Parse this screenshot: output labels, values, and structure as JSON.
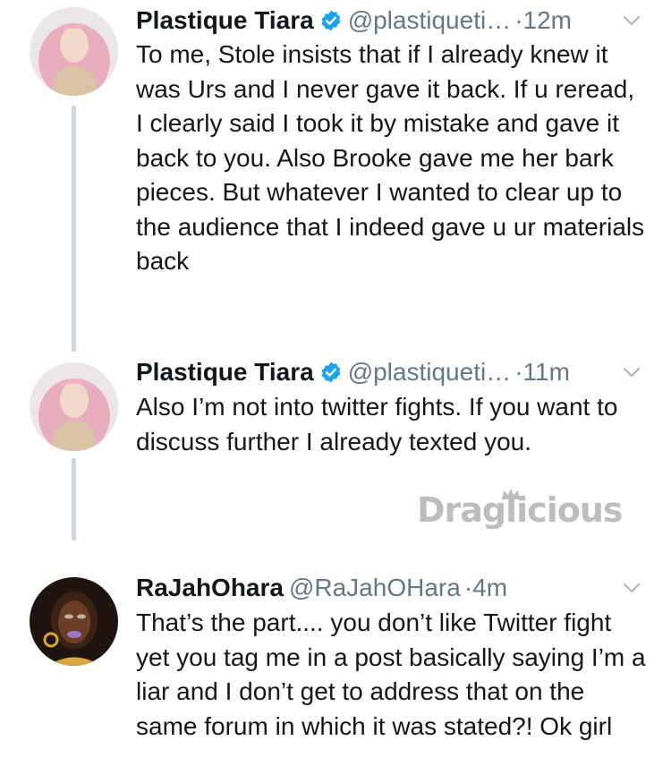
{
  "tweets": [
    {
      "name": "Plastique Tiara",
      "verified": true,
      "handle": "@plastiqueti…",
      "time": "12m",
      "text": "To me, Stole insists that if I already knew it was Urs and I never gave it back. If u reread, I clearly said I took it by mistake and gave it back to you. Also Brooke gave me her bark pieces. But whatever I wanted to clear up to the audience that I indeed gave u ur materials back"
    },
    {
      "name": "Plastique Tiara",
      "verified": true,
      "handle": "@plastiqueti…",
      "time": "11m",
      "text": "Also I’m not into twitter fights. If you want to discuss further I already texted you."
    },
    {
      "name": "RaJahOhara",
      "verified": false,
      "handle": "@RaJahOHara",
      "time": "4m",
      "text": "That’s the part.... you don’t like Twitter fight yet you tag me in a post basically saying I’m a liar and I don’t get to address that on the same forum in which it was stated?! Ok girl"
    }
  ],
  "separator": "·",
  "watermark": "Draglicious",
  "icons": {
    "verified": "verified-badge-icon",
    "caret": "chevron-down-icon"
  },
  "colors": {
    "name": "#14171a",
    "secondary": "#657786",
    "verified": "#1da1f2",
    "thread_line": "#ccd6dd"
  }
}
